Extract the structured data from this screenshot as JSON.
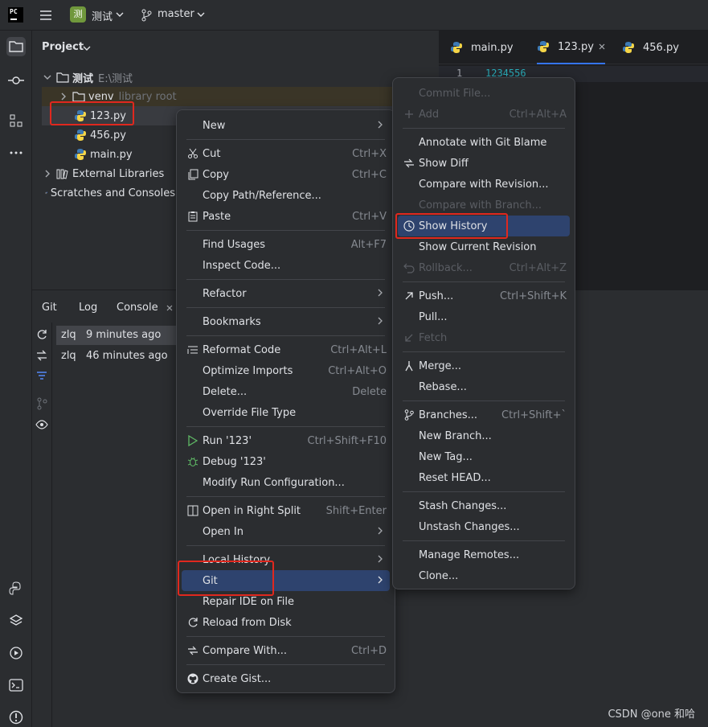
{
  "titlebar": {
    "logo": "PC",
    "project_badge": "测",
    "project_name": "测试",
    "branch": "master"
  },
  "project_panel": {
    "title": "Project",
    "root_name": "测试",
    "root_path": "E:\\测试",
    "venv_name": "venv",
    "venv_hint": "library root",
    "files": [
      "123.py",
      "456.py",
      "main.py"
    ],
    "external_libraries": "External Libraries",
    "scratches": "Scratches and Consoles"
  },
  "editor": {
    "tabs": [
      "main.py",
      "123.py",
      "456.py"
    ],
    "line_number": "1",
    "line_text": "1234556"
  },
  "bottom_panel": {
    "tabs": [
      "Git",
      "Log",
      "Console"
    ],
    "commits": [
      {
        "author": "zlq",
        "time": "9 minutes ago"
      },
      {
        "author": "zlq",
        "time": "46 minutes ago"
      }
    ]
  },
  "context_menu": {
    "new": "New",
    "cut": "Cut",
    "cut_sc": "Ctrl+X",
    "copy": "Copy",
    "copy_sc": "Ctrl+C",
    "copy_path": "Copy Path/Reference...",
    "paste": "Paste",
    "paste_sc": "Ctrl+V",
    "find_usages": "Find Usages",
    "find_usages_sc": "Alt+F7",
    "inspect_code": "Inspect Code...",
    "refactor": "Refactor",
    "bookmarks": "Bookmarks",
    "reformat": "Reformat Code",
    "reformat_sc": "Ctrl+Alt+L",
    "optimize": "Optimize Imports",
    "optimize_sc": "Ctrl+Alt+O",
    "delete": "Delete...",
    "delete_sc": "Delete",
    "override": "Override File Type",
    "run": "Run '123'",
    "run_sc": "Ctrl+Shift+F10",
    "debug": "Debug '123'",
    "modify_run": "Modify Run Configuration...",
    "open_right": "Open in Right Split",
    "open_right_sc": "Shift+Enter",
    "open_in": "Open In",
    "local_history": "Local History",
    "git": "Git",
    "repair": "Repair IDE on File",
    "reload": "Reload from Disk",
    "compare_with": "Compare With...",
    "compare_with_sc": "Ctrl+D",
    "create_gist": "Create Gist..."
  },
  "git_menu": {
    "commit_file": "Commit File...",
    "add": "Add",
    "add_sc": "Ctrl+Alt+A",
    "annotate": "Annotate with Git Blame",
    "show_diff": "Show Diff",
    "compare_revision": "Compare with Revision...",
    "compare_branch": "Compare with Branch...",
    "show_history": "Show History",
    "show_current": "Show Current Revision",
    "rollback": "Rollback...",
    "rollback_sc": "Ctrl+Alt+Z",
    "push": "Push...",
    "push_sc": "Ctrl+Shift+K",
    "pull": "Pull...",
    "fetch": "Fetch",
    "merge": "Merge...",
    "rebase": "Rebase...",
    "branches": "Branches...",
    "branches_sc": "Ctrl+Shift+`",
    "new_branch": "New Branch...",
    "new_tag": "New Tag...",
    "reset_head": "Reset HEAD...",
    "stash": "Stash Changes...",
    "unstash": "Unstash Changes...",
    "manage_remotes": "Manage Remotes...",
    "clone": "Clone..."
  },
  "watermark": "CSDN @one 和哈",
  "colors": {
    "accent": "#2e436e",
    "highlight_box": "#e0281e",
    "python_blue": "#3d7ab5",
    "python_yellow": "#f5d547"
  }
}
